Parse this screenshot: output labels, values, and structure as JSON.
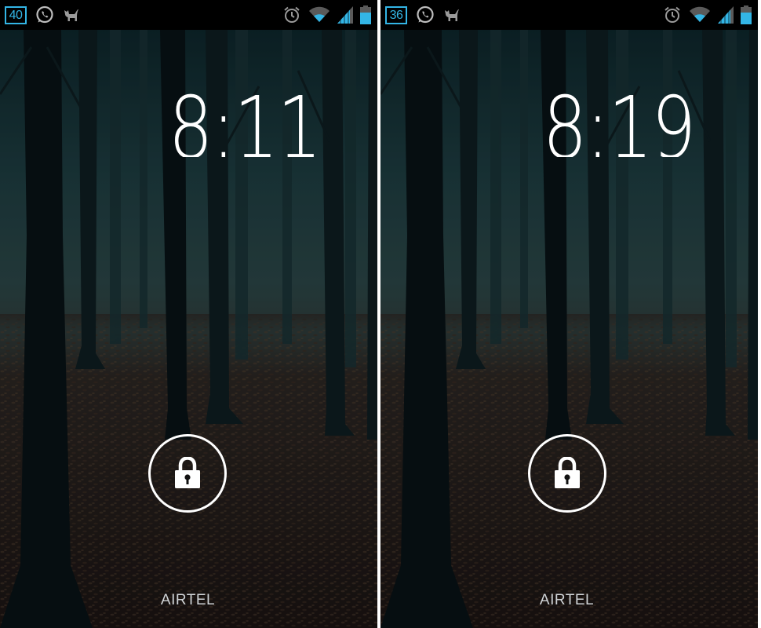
{
  "screens": [
    {
      "status": {
        "notification_count": "40"
      },
      "clock": "8:11",
      "carrier": "AIRTEL"
    },
    {
      "status": {
        "notification_count": "36"
      },
      "clock": "8:19",
      "carrier": "AIRTEL"
    }
  ],
  "icons": {
    "status_left": [
      "notification-count-icon",
      "whatsapp-icon",
      "cat-icon"
    ],
    "status_right": [
      "alarm-icon",
      "wifi-icon",
      "signal-icon",
      "battery-icon"
    ],
    "unlock": "lock-icon"
  },
  "colors": {
    "accent": "#33b5e5",
    "status_bar": "#000000",
    "text": "#ffffff",
    "icon_gray": "#9a9a9a"
  }
}
